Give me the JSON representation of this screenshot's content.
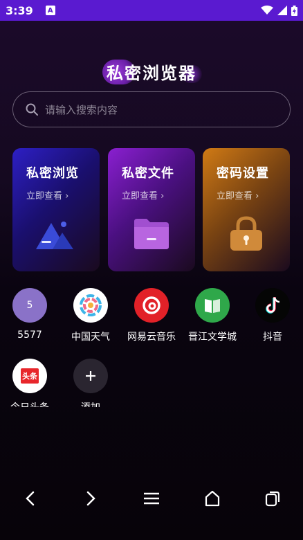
{
  "status": {
    "time": "3:39",
    "badge": "A"
  },
  "app": {
    "title": "私密浏览器"
  },
  "search": {
    "placeholder": "请输入搜索内容"
  },
  "cards": [
    {
      "title": "私密浏览",
      "subtitle": "立即查看 ›",
      "icon": "mountain-icon"
    },
    {
      "title": "私密文件",
      "subtitle": "立即查看 ›",
      "icon": "folder-icon"
    },
    {
      "title": "密码设置",
      "subtitle": "立即查看 ›",
      "icon": "lock-icon"
    }
  ],
  "shortcuts": [
    {
      "label": "5577",
      "icon_text": "5",
      "icon": "number-icon"
    },
    {
      "label": "中国天气",
      "icon": "weather-icon"
    },
    {
      "label": "网易云音乐",
      "icon": "netease-music-icon"
    },
    {
      "label": "晋江文学城",
      "icon": "jinjiang-icon"
    },
    {
      "label": "抖音",
      "icon": "tiktok-icon"
    },
    {
      "label": "今日头条",
      "icon_text": "头条",
      "icon": "toutiao-icon"
    },
    {
      "label": "添加",
      "icon": "plus-icon"
    }
  ],
  "colors": {
    "status_bar": "#5a1ad0",
    "card_blue": "#2d1fc4",
    "card_purple": "#8a1fd0",
    "card_orange": "#d07a15"
  }
}
